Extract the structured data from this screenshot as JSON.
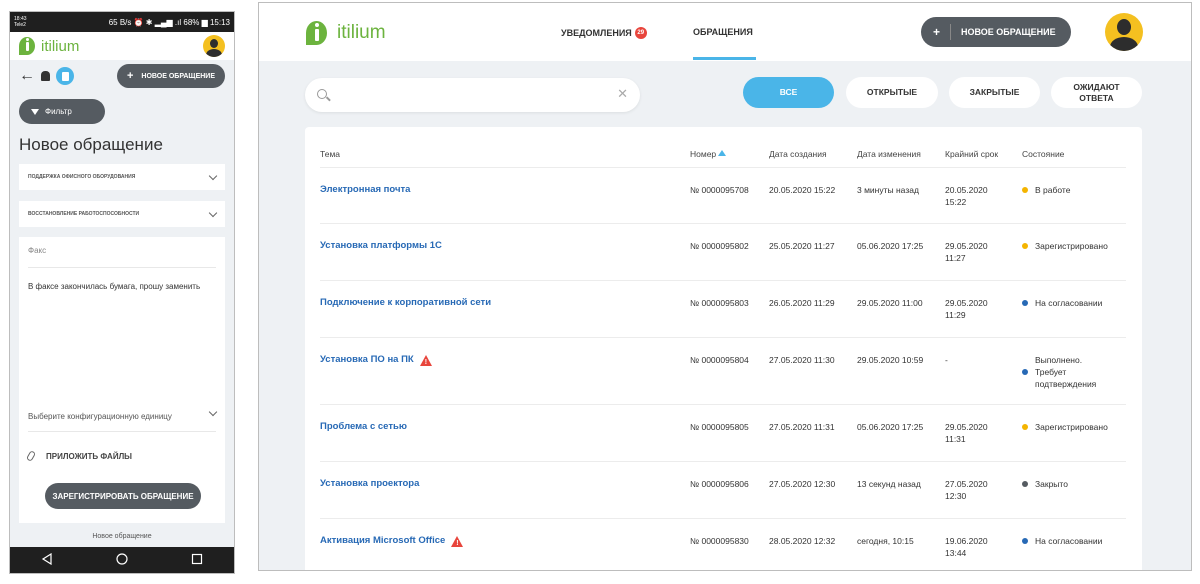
{
  "mobile": {
    "status": {
      "left_top": "18:43",
      "left_bottom": "Tele2",
      "right": "65 B/s ⏰ ✱ ▂▄▆ .ıl 68% ▆ 15:13"
    },
    "app_name": "itilium",
    "new_request_label": "НОВОЕ ОБРАЩЕНИЕ",
    "filter_label": "Фильтр",
    "page_title": "Новое обращение",
    "service_select": "ПОДДЕРЖКА ОФИСНОГО ОБОРУДОВАНИЯ",
    "component_select": "ВОССТАНОВЛЕНИЕ РАБОТОСПОСОБНОСТИ",
    "subject_value": "Факс",
    "description_value": "В факсе закончилась бумага, прошу заменить",
    "config_placeholder": "Выберите конфигурационную единицу",
    "attach_label": "ПРИЛОЖИТЬ ФАЙЛЫ",
    "register_label": "ЗАРЕГИСТРИРОВАТЬ ОБРАЩЕНИЕ",
    "bottom_caption": "Новое обращение"
  },
  "desktop": {
    "app_name": "itilium",
    "tabs": [
      {
        "label": "УВЕДОМЛЕНИЯ",
        "badge": "29"
      },
      {
        "label": "ОБРАЩЕНИЯ",
        "active": true
      }
    ],
    "new_request_label": "НОВОЕ ОБРАЩЕНИЕ",
    "search": {
      "value": "",
      "placeholder": ""
    },
    "filters": [
      {
        "label": "ВСЕ",
        "active": true
      },
      {
        "label": "ОТКРЫТЫЕ"
      },
      {
        "label": "ЗАКРЫТЫЕ"
      },
      {
        "label": "ОЖИДАЮТ ОТВЕТА"
      }
    ],
    "columns": [
      "Тема",
      "Номер",
      "Дата создания",
      "Дата изменения",
      "Крайний срок",
      "Состояние"
    ],
    "rows": [
      {
        "topic": "Электронная почта",
        "number": "№ 0000095708",
        "created": "20.05.2020 15:22",
        "modified": "3 минуты назад",
        "deadline": "20.05.2020\n15:22",
        "status": "В работе",
        "status_color": "#f4b400",
        "warning": false
      },
      {
        "topic": "Установка платформы 1С",
        "number": "№ 0000095802",
        "created": "25.05.2020 11:27",
        "modified": "05.06.2020 17:25",
        "deadline": "29.05.2020\n11:27",
        "status": "Зарегистрировано",
        "status_color": "#f4b400",
        "warning": false
      },
      {
        "topic": "Подключение к корпоративной сети",
        "number": "№ 0000095803",
        "created": "26.05.2020 11:29",
        "modified": "29.05.2020 11:00",
        "deadline": "29.05.2020\n11:29",
        "status": "На согласовании",
        "status_color": "#2769b5",
        "warning": false
      },
      {
        "topic": "Установка ПО на ПК",
        "number": "№ 0000095804",
        "created": "27.05.2020 11:30",
        "modified": "29.05.2020 10:59",
        "deadline": "-",
        "status": "Выполнено.\nТребует\nподтверждения",
        "status_color": "#2769b5",
        "warning": true
      },
      {
        "topic": "Проблема с сетью",
        "number": "№ 0000095805",
        "created": "27.05.2020 11:31",
        "modified": "05.06.2020 17:25",
        "deadline": "29.05.2020\n11:31",
        "status": "Зарегистрировано",
        "status_color": "#f4b400",
        "warning": false
      },
      {
        "topic": "Установка проектора",
        "number": "№ 0000095806",
        "created": "27.05.2020 12:30",
        "modified": "13 секунд назад",
        "deadline": "27.05.2020\n12:30",
        "status": "Закрыто",
        "status_color": "#555b61",
        "warning": false
      },
      {
        "topic": "Активация Microsoft Office",
        "number": "№ 0000095830",
        "created": "28.05.2020 12:32",
        "modified": "сегодня, 10:15",
        "deadline": "19.06.2020\n13:44",
        "status": "На согласовании",
        "status_color": "#2769b5",
        "warning": true
      }
    ]
  }
}
